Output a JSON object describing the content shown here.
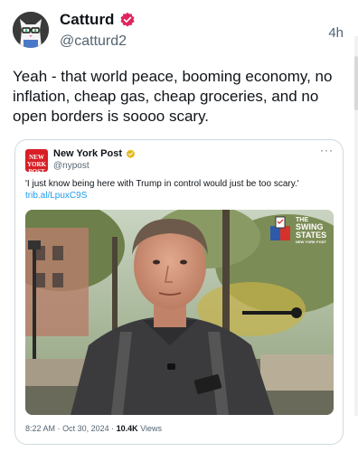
{
  "author": {
    "display_name": "Catturd",
    "handle": "@catturd2",
    "timestamp": "4h",
    "verified_badge_color": "#e0245e"
  },
  "tweet": {
    "text": "Yeah - that world peace, booming economy, no inflation, cheap gas, cheap groceries, and no open borders is soooo scary."
  },
  "quoted_tweet": {
    "avatar_text": "NEW YORK POST",
    "display_name": "New York Post",
    "handle": "@nypost",
    "verified_badge_color": "#e2b719",
    "more_icon": "ellipsis-icon",
    "text": "'I just know being here with Trump in control would just be too scary.'",
    "link": "trib.al/LpuxC9S",
    "media": {
      "logo_lines": [
        "THE",
        "SWING",
        "STATES"
      ],
      "logo_subtext": "NEW YORK POST"
    },
    "meta": {
      "time": "8:22 AM",
      "separator": "·",
      "date": "Oct 30, 2024",
      "separator2": "·",
      "views_count": "10.4K",
      "views_label": "Views"
    }
  },
  "colors": {
    "link": "#1d9bf0",
    "secondary_text": "#536471",
    "nypost_red": "#d81f26"
  }
}
